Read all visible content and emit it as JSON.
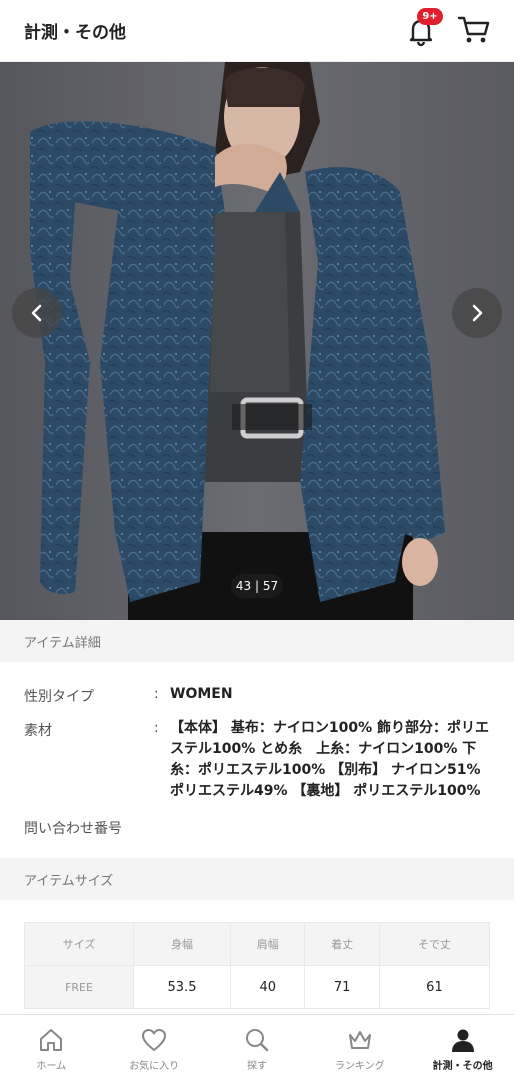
{
  "header": {
    "title": "計測・その他",
    "notification_badge": "9+",
    "bell_icon": "bell-icon",
    "cart_icon": "cart-icon"
  },
  "carousel": {
    "counter": "43 | 57",
    "prev_icon": "chevron-left-icon",
    "next_icon": "chevron-right-icon"
  },
  "item_details": {
    "heading": "アイテム詳細",
    "gender_label": "性別タイプ",
    "gender_value": "WOMEN",
    "material_label": "素材",
    "material_value": "【本体】 基布：ナイロン100% 飾り部分：ポリエステル100% とめ糸　上糸：ナイロン100% 下糸：ポリエステル100% 【別布】 ナイロン51% ポリエステル49% 【裏地】 ポリエステル100%",
    "inquiry_label": "問い合わせ番号",
    "colon": ":"
  },
  "item_size": {
    "heading": "アイテムサイズ",
    "headers": [
      "サイズ",
      "身幅",
      "肩幅",
      "着丈",
      "そで丈"
    ],
    "rows": [
      [
        "FREE",
        "53.5",
        "40",
        "71",
        "61"
      ]
    ]
  },
  "bottom_nav": [
    {
      "label": "ホーム",
      "icon": "home-icon"
    },
    {
      "label": "お気に入り",
      "icon": "heart-icon"
    },
    {
      "label": "探す",
      "icon": "search-icon"
    },
    {
      "label": "ランキング",
      "icon": "crown-icon"
    },
    {
      "label": "計測・その他",
      "icon": "person-icon",
      "active": true
    }
  ],
  "colors": {
    "badge": "#e0212d",
    "section_bg": "#f4f4f4",
    "jacket": "#2c4a66"
  }
}
